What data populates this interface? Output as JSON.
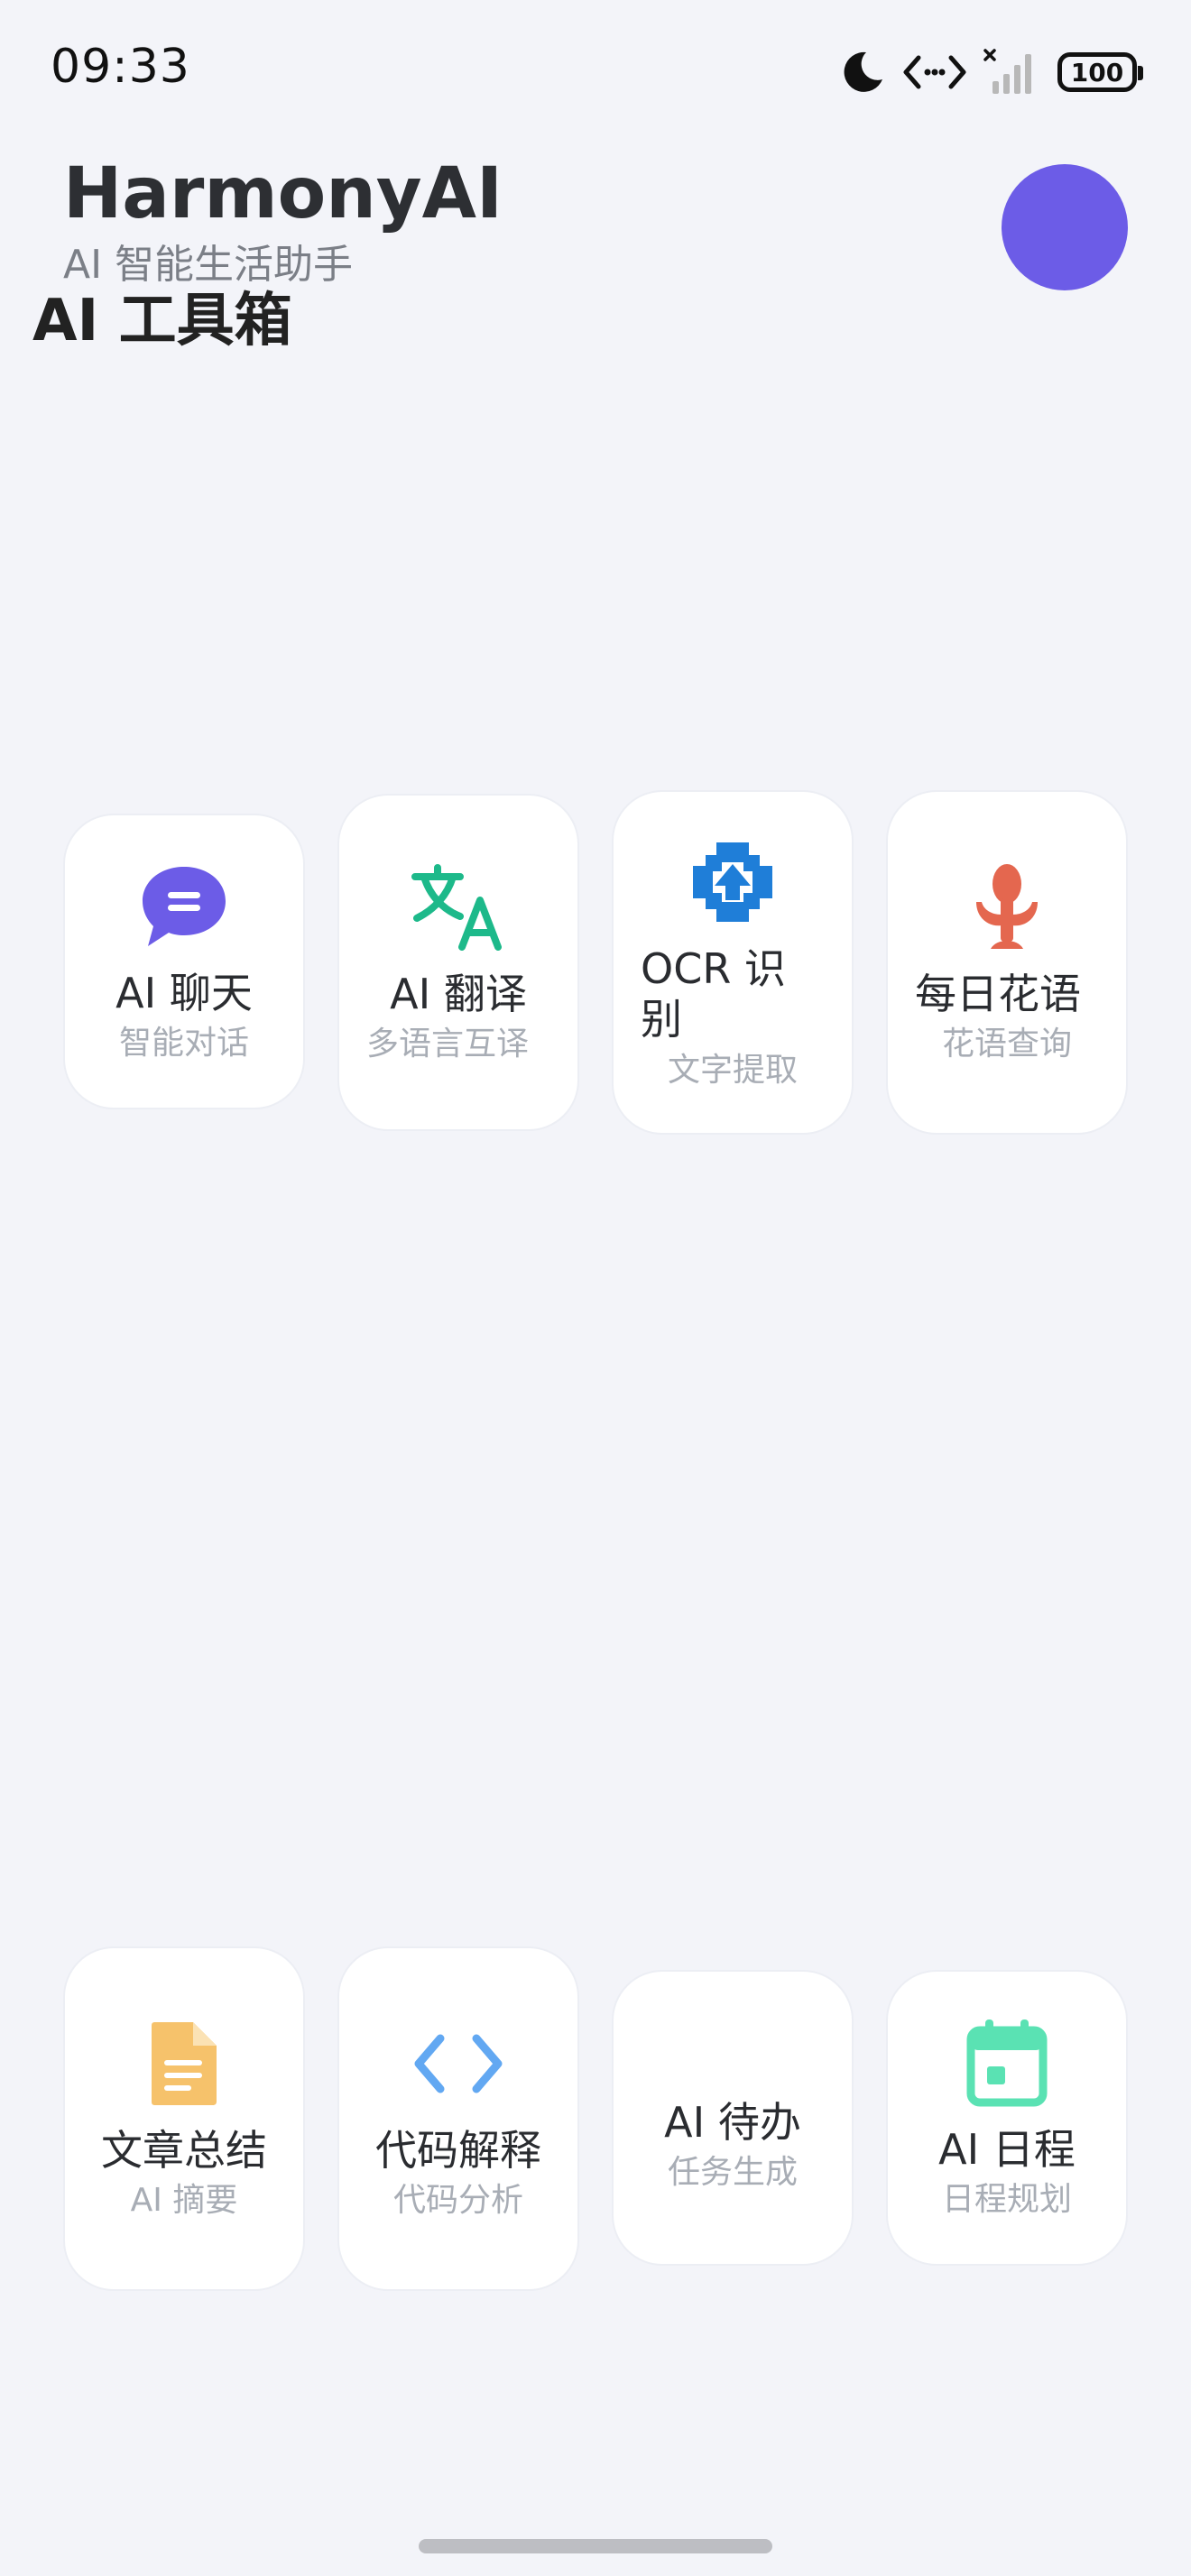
{
  "status_bar": {
    "time": "09:33",
    "battery": "100"
  },
  "header": {
    "title": "HarmonyAI",
    "subtitle": "AI 智能生活助手"
  },
  "section": {
    "title": "AI 工具箱"
  },
  "tools": [
    {
      "title": "AI 聊天",
      "desc": "智能对话",
      "icon": "chat-bubble-icon",
      "color": "#6c5ce7"
    },
    {
      "title": "AI 翻译",
      "desc": "多语言互译",
      "icon": "translate-icon",
      "color": "#1db98a"
    },
    {
      "title": "OCR 识别",
      "desc": "文字提取",
      "icon": "ocr-scan-icon",
      "color": "#1f7ed8"
    },
    {
      "title": "每日花语",
      "desc": "花语查询",
      "icon": "flower-icon",
      "color": "#e4674f"
    },
    {
      "title": "文章总结",
      "desc": "AI 摘要",
      "icon": "document-icon",
      "color": "#f6c26b"
    },
    {
      "title": "代码解释",
      "desc": "代码分析",
      "icon": "code-icon",
      "color": "#62a8f2"
    },
    {
      "title": "AI 待办",
      "desc": "任务生成",
      "icon": "",
      "color": ""
    },
    {
      "title": "AI 日程",
      "desc": "日程规划",
      "icon": "calendar-icon",
      "color": "#5ae2b3"
    }
  ],
  "colors": {
    "background": "#f3f4f9",
    "avatar": "#6c5ce7"
  }
}
